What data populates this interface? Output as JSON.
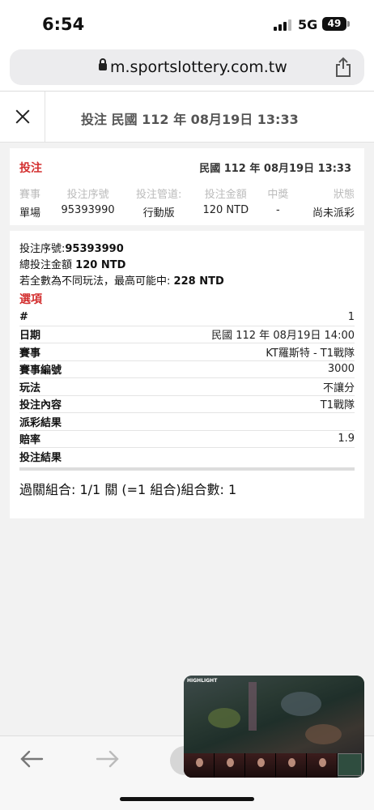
{
  "status_bar": {
    "time": "6:54",
    "network": "5G",
    "battery": "49"
  },
  "browser": {
    "url": "m.sportslottery.com.tw"
  },
  "header": {
    "title": "投注 民國 112 年 08月19日 13:33"
  },
  "summary": {
    "label": "投注",
    "date": "民國 112 年 08月19日 13:33",
    "columns": [
      "賽事",
      "投注序號",
      "投注管道:",
      "投注金額",
      "中獎",
      "狀態"
    ],
    "values": [
      "單場",
      "95393990",
      "行動版",
      "120 NTD",
      "-",
      "尚未派彩"
    ]
  },
  "details": {
    "serial_label": "投注序號:",
    "serial_value": "95393990",
    "total_label": "總投注金額",
    "total_value": "120 NTD",
    "max_win_label": "若全數為不同玩法，最高可能中:",
    "max_win_value": "228 NTD",
    "options_label": "選項",
    "rows": [
      {
        "key": "#",
        "value": "1"
      },
      {
        "key": "日期",
        "value": "民國 112 年 08月19日 14:00"
      },
      {
        "key": "賽事",
        "value": "KT羅斯特 - T1戰隊"
      },
      {
        "key": "賽事編號",
        "value": "3000"
      },
      {
        "key": "玩法",
        "value": "不讓分"
      },
      {
        "key": "投注內容",
        "value": "T1戰隊"
      },
      {
        "key": "派彩結果",
        "value": ""
      },
      {
        "key": "賠率",
        "value": "1.9"
      },
      {
        "key": "投注結果",
        "value": ""
      }
    ],
    "combo": "過關組合: 1/1 關 (=1 組合)組合數: 1"
  },
  "pip": {
    "badge": "HIGHLIGHT"
  },
  "icons": [
    "lock-icon",
    "share-icon",
    "close-icon",
    "back-arrow-icon",
    "forward-arrow-icon"
  ],
  "colors": {
    "accent_red": "#d32f2f"
  }
}
